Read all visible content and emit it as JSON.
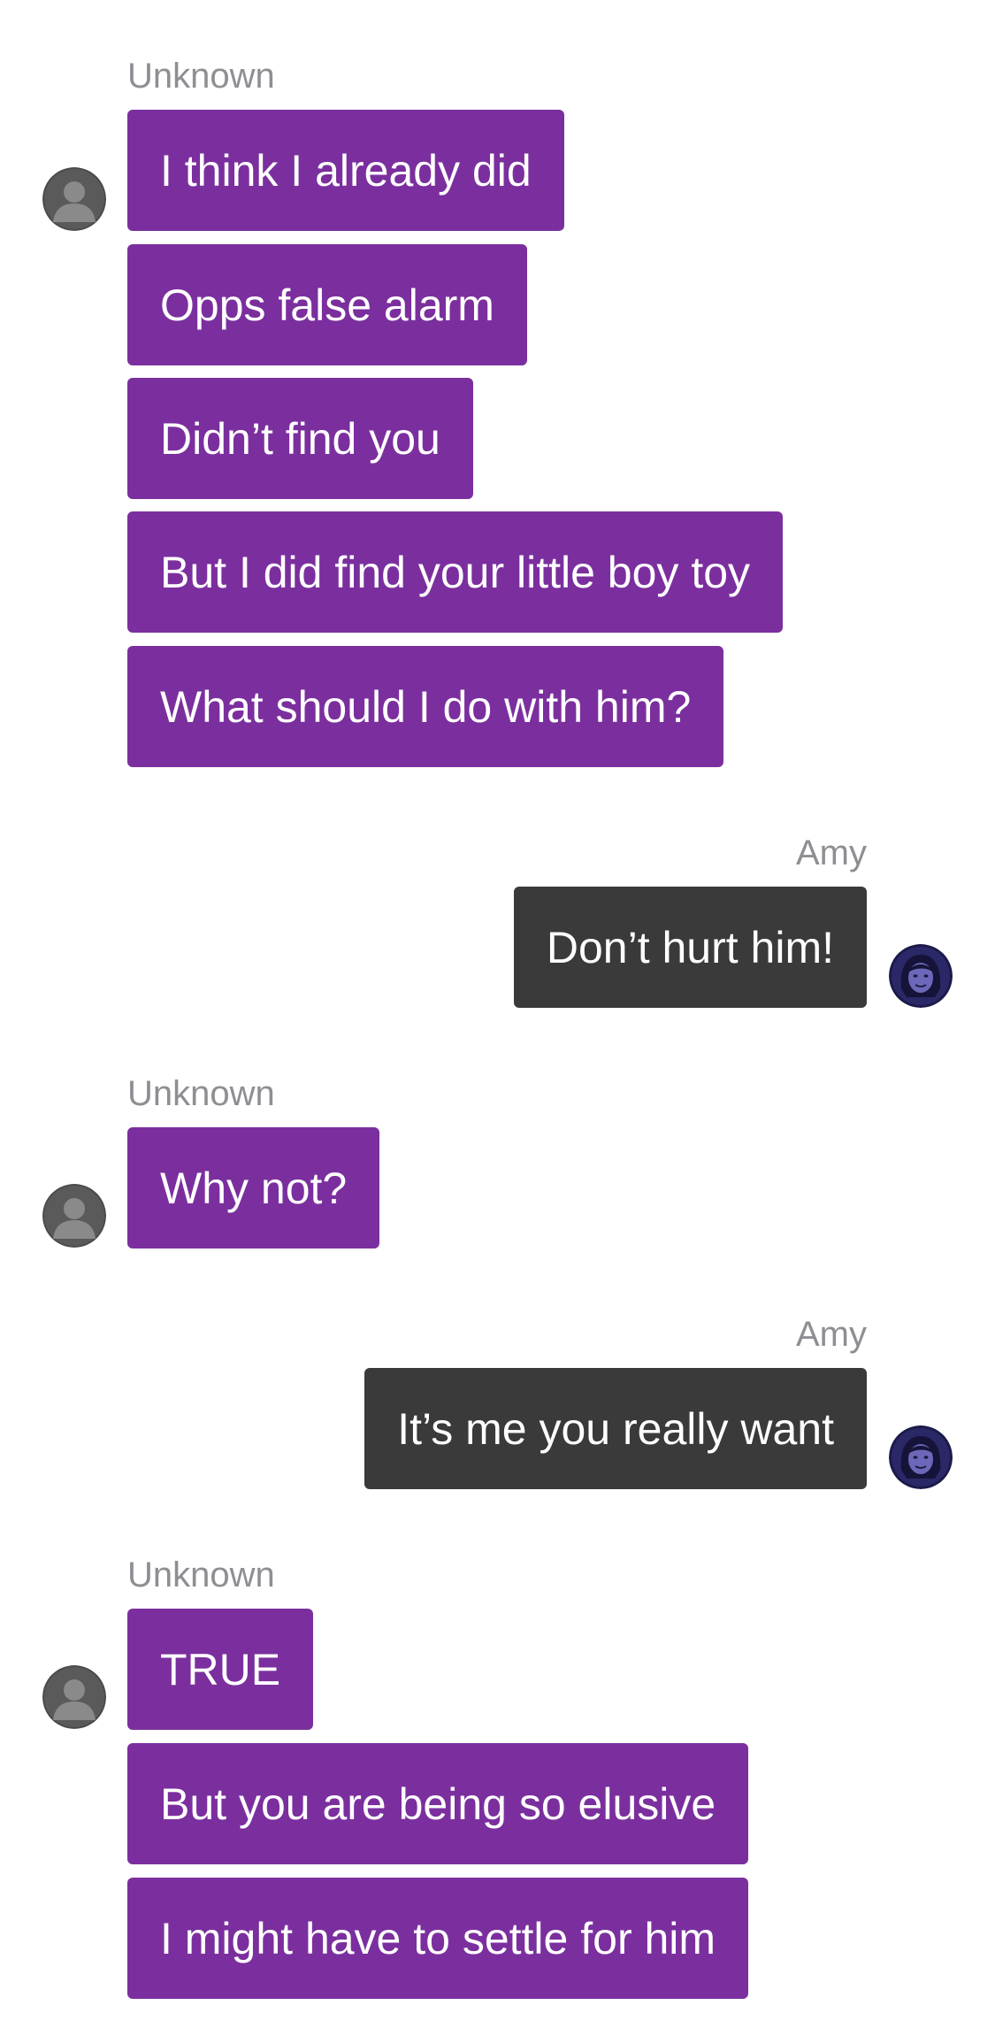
{
  "colors": {
    "incoming_bubble": "#7b2f9e",
    "outgoing_bubble": "#3a3a3a",
    "sender_label": "#8e8e93",
    "text": "#ffffff"
  },
  "messages": [
    {
      "sender": "Unknown",
      "direction": "incoming",
      "avatar_icon": "default-person-avatar-icon",
      "bubbles": [
        "I think I already did",
        "Opps false alarm",
        "Didn’t find you",
        "But I did find your little boy toy",
        "What should I do with him?"
      ]
    },
    {
      "sender": "Amy",
      "direction": "outgoing",
      "avatar_icon": "amy-portrait-avatar-icon",
      "bubbles": [
        "Don’t hurt him!"
      ]
    },
    {
      "sender": "Unknown",
      "direction": "incoming",
      "avatar_icon": "default-person-avatar-icon",
      "bubbles": [
        "Why not?"
      ]
    },
    {
      "sender": "Amy",
      "direction": "outgoing",
      "avatar_icon": "amy-portrait-avatar-icon",
      "bubbles": [
        "It’s me you really want"
      ]
    },
    {
      "sender": "Unknown",
      "direction": "incoming",
      "avatar_icon": "default-person-avatar-icon",
      "bubbles": [
        "TRUE",
        "But you are being so elusive",
        "I might have to settle for him"
      ]
    }
  ]
}
